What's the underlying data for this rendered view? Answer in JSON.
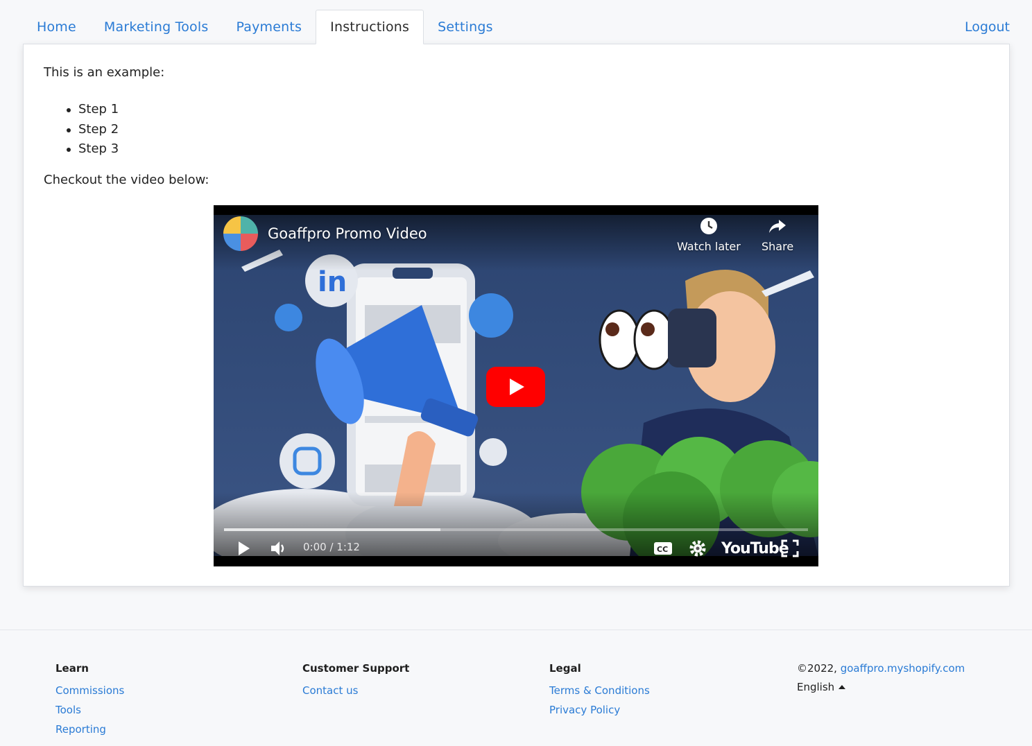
{
  "nav": {
    "tabs": [
      {
        "label": "Home"
      },
      {
        "label": "Marketing Tools"
      },
      {
        "label": "Payments"
      },
      {
        "label": "Instructions",
        "active": true
      },
      {
        "label": "Settings"
      }
    ],
    "logout_label": "Logout"
  },
  "content": {
    "intro": "This is an example:",
    "steps": [
      "Step 1",
      "Step 2",
      "Step 3"
    ],
    "video_prompt": "Checkout the video below:"
  },
  "video": {
    "title": "Goaffpro Promo Video",
    "watch_later_label": "Watch later",
    "share_label": "Share",
    "time_current": "0:00",
    "time_total": "1:12",
    "time_display": "0:00 / 1:12",
    "loaded_fraction": 0.37,
    "brand": "YouTube",
    "play_button_color": "#ff0000"
  },
  "footer": {
    "learn": {
      "heading": "Learn",
      "links": [
        "Commissions",
        "Tools",
        "Reporting"
      ]
    },
    "support": {
      "heading": "Customer Support",
      "links": [
        "Contact us"
      ]
    },
    "legal": {
      "heading": "Legal",
      "links": [
        "Terms & Conditions",
        "Privacy Policy"
      ]
    },
    "copyright_prefix": "©2022,",
    "shop_domain": "goaffpro.myshopify.com",
    "language": "English"
  },
  "colors": {
    "link": "#2a7bd5",
    "background": "#f7f8fa",
    "card": "#ffffff"
  }
}
